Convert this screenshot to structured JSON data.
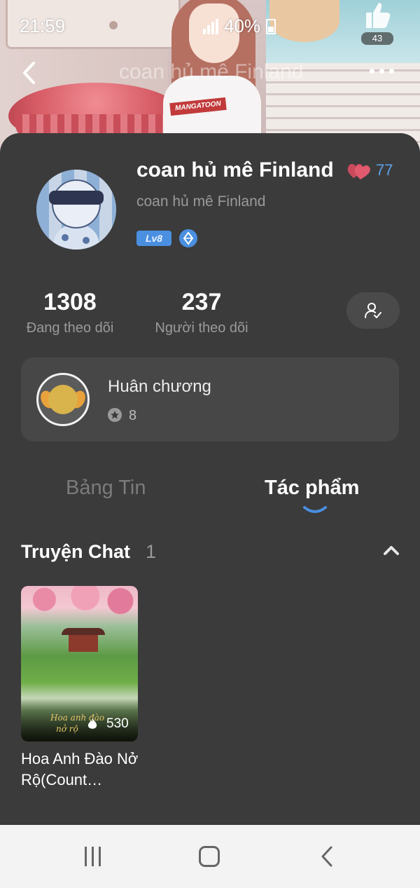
{
  "status_bar": {
    "time": "21:59",
    "battery": "40%"
  },
  "header": {
    "title": "coan hủ mê Finland",
    "like_count": "43",
    "banner_tag": "MANGATOON"
  },
  "profile": {
    "name": "coan hủ mê Finland",
    "handle": "coan hủ mê Finland",
    "hearts": "77",
    "level_badge": "Lv8",
    "following_count": "1308",
    "following_label": "Đang theo dõi",
    "followers_count": "237",
    "followers_label": "Người theo dõi"
  },
  "medal": {
    "title": "Huân chương",
    "count": "8"
  },
  "tabs": [
    {
      "label": "Bảng Tin",
      "active": false
    },
    {
      "label": "Tác phẩm",
      "active": true
    }
  ],
  "section": {
    "title": "Truyện Chat",
    "count": "1"
  },
  "stories": [
    {
      "cover_text_line1": "Hoa anh đào",
      "cover_text_line2": "nở rộ",
      "views": "530",
      "title": "Hoa Anh Đào Nở Rộ(Count…"
    }
  ],
  "colors": {
    "accent": "#4a8fe0",
    "card_bg": "#3b3b3b",
    "heart": "#e05a6e"
  },
  "icons": [
    "back-icon",
    "more-icon",
    "thumb-up-icon",
    "follow-user-icon",
    "medal-icon",
    "star-icon",
    "chevron-up-icon",
    "fire-icon",
    "recents-icon",
    "home-icon",
    "nav-back-icon"
  ]
}
